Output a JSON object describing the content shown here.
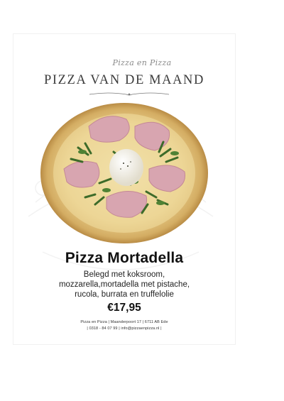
{
  "header": {
    "brand_script": "Pizza en Pizza",
    "headline": "PIZZA VAN DE MAAND"
  },
  "product": {
    "name": "Pizza Mortadella",
    "description_lines": [
      "Belegd met koksroom,",
      "mozzarella,mortadella met pistache,",
      "rucola, burrata en truffelolie"
    ],
    "price": "€17,95"
  },
  "footer": {
    "line1": "Pizza en Pizza | Maanderpoort 17 | 6711 AB Ede",
    "line2": "| 0318 - 84 07 99 | info@pizzaenpizza.nl |"
  },
  "colors": {
    "crust": "#d9b774",
    "ham": "#d8a5b0",
    "arugula": "#3d6b2a",
    "burrata": "#f3f0e6",
    "text_dark": "#111111",
    "headline": "#3b3b3b"
  }
}
